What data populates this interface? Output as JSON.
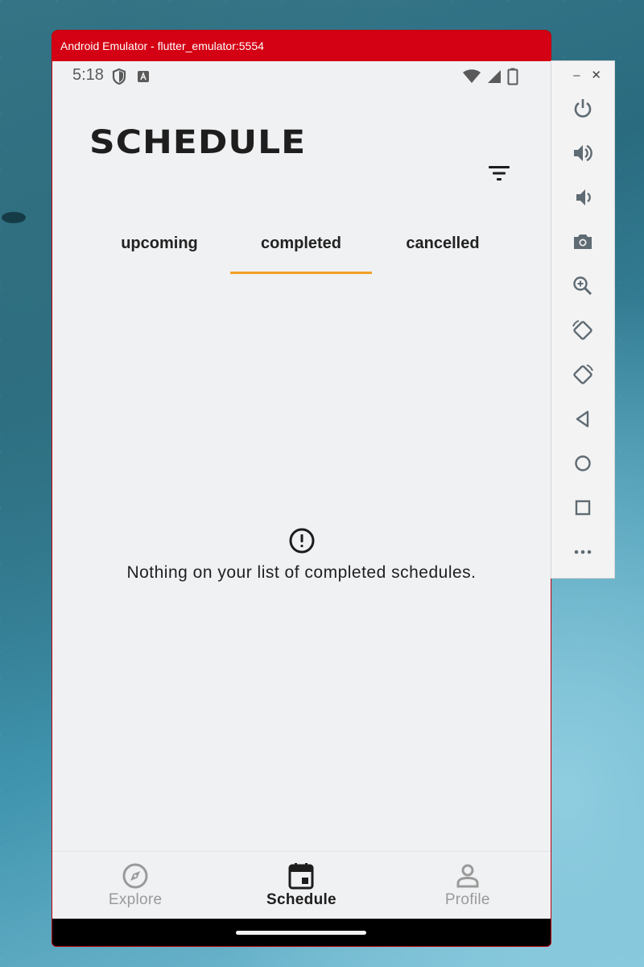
{
  "emulator": {
    "title": "Android Emulator - flutter_emulator:5554",
    "minimize_label": "–",
    "close_label": "✕",
    "toolbar_icons": [
      "power-icon",
      "volume-up-icon",
      "volume-down-icon",
      "camera-icon",
      "zoom-icon",
      "rotate-left-icon",
      "rotate-right-icon",
      "back-icon",
      "home-icon",
      "overview-icon",
      "more-icon"
    ]
  },
  "status_bar": {
    "time": "5:18",
    "icons": [
      "shield-icon",
      "a-badge-icon",
      "wifi-icon",
      "cellular-icon",
      "battery-icon"
    ]
  },
  "header": {
    "title": "SCHEDULE",
    "filter_icon": "filter-icon"
  },
  "tabs": [
    {
      "label": "upcoming",
      "active": false
    },
    {
      "label": "completed",
      "active": true
    },
    {
      "label": "cancelled",
      "active": false
    }
  ],
  "empty_state": {
    "icon": "alert-circle-icon",
    "message": "Nothing on your list of completed schedules."
  },
  "bottom_nav": [
    {
      "label": "Explore",
      "icon": "compass-icon",
      "active": false
    },
    {
      "label": "Schedule",
      "icon": "calendar-icon",
      "active": true
    },
    {
      "label": "Profile",
      "icon": "person-icon",
      "active": false
    }
  ],
  "colors": {
    "tab_indicator": "#f0a126",
    "title_bar": "#d40013",
    "app_background": "#f0f1f3"
  }
}
